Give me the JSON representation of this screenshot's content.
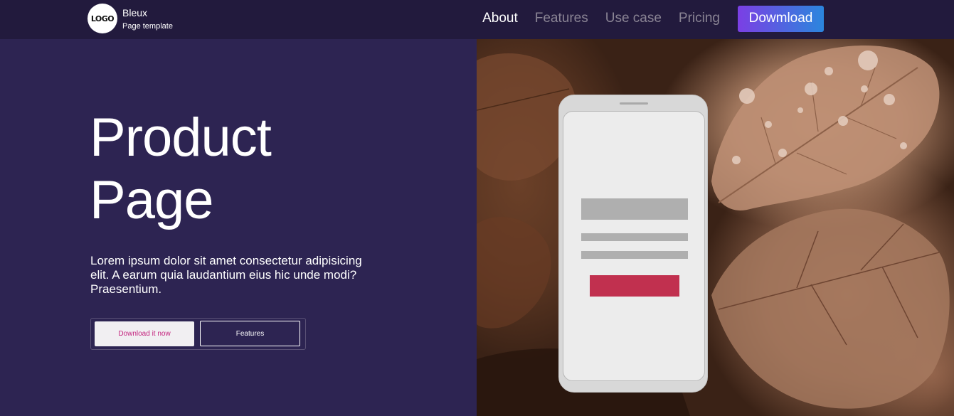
{
  "brand": {
    "logo_text": "LOGO",
    "name": "Bleux",
    "tagline": "Page template"
  },
  "nav": {
    "links": [
      "About",
      "Features",
      "Use case",
      "Pricing"
    ],
    "cta": "Dowmload"
  },
  "hero": {
    "title_line1": "Product",
    "title_line2": "Page",
    "description": "Lorem ipsum dolor sit amet consectetur adipisicing elit. A earum quia laudantium eius hic unde modi? Praesentium.",
    "primary_button": "Download it now",
    "secondary_button": "Features"
  },
  "colors": {
    "nav_bg": "#221a3d",
    "hero_bg": "#2d2452",
    "cta_gradient_start": "#7b3fe4",
    "cta_gradient_end": "#2b86dd",
    "primary_button_text": "#c4257f",
    "phone_button": "#c1304f"
  },
  "icons": {
    "phone_mockup": "smartphone-illustration",
    "background": "autumn-leaves-photo"
  }
}
